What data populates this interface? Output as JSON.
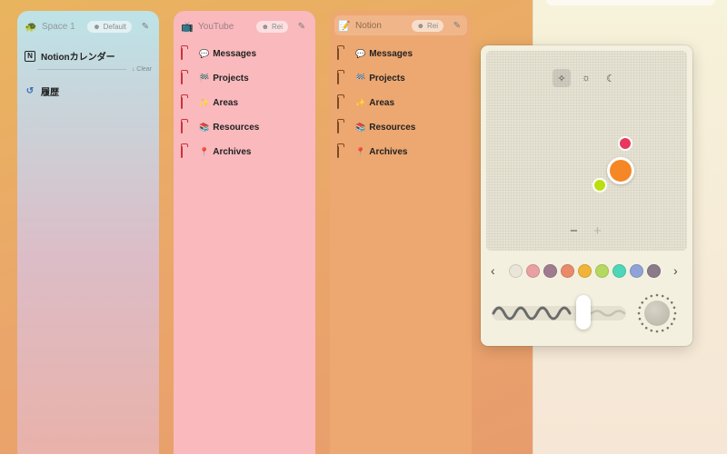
{
  "spaces": [
    {
      "title": "Space 1",
      "icon": "turtle-icon",
      "badge": "Default",
      "items": [
        {
          "label": "Notionカレンダー",
          "icon": "notion-logo-icon"
        }
      ],
      "clear_label": "↓ Clear",
      "history_label": "履歴"
    },
    {
      "title": "YouTube",
      "icon": "tv-icon",
      "badge": "Rei",
      "items": [
        {
          "label": "Messages",
          "emoji": "💬"
        },
        {
          "label": "Projects",
          "emoji": "🏁"
        },
        {
          "label": "Areas",
          "emoji": "✨"
        },
        {
          "label": "Resources",
          "emoji": "📚"
        },
        {
          "label": "Archives",
          "emoji": "📍"
        }
      ]
    },
    {
      "title": "Notion",
      "icon": "notepad-icon",
      "badge": "Rei",
      "items": [
        {
          "label": "Messages",
          "emoji": "💬"
        },
        {
          "label": "Projects",
          "emoji": "🏁"
        },
        {
          "label": "Areas",
          "emoji": "✨"
        },
        {
          "label": "Resources",
          "emoji": "📚"
        },
        {
          "label": "Archives",
          "emoji": "📍"
        }
      ]
    }
  ],
  "color_picker": {
    "modes": [
      "sparkle-icon",
      "sun-icon",
      "moon-icon"
    ],
    "active_mode": "sparkle-icon",
    "points": [
      {
        "name": "pink",
        "color": "#e8385e"
      },
      {
        "name": "orange",
        "color": "#f58727"
      },
      {
        "name": "lime",
        "color": "#b9e00e"
      }
    ],
    "zoom_out_label": "−",
    "zoom_in_label": "+",
    "swatches": [
      "#e9e5d8",
      "#e9a0a3",
      "#a07b8f",
      "#e98a6a",
      "#f1b43a",
      "#b4d860",
      "#4fd6b8",
      "#8fa3d8",
      "#8a7a8a"
    ],
    "prev_label": "‹",
    "next_label": "›"
  }
}
